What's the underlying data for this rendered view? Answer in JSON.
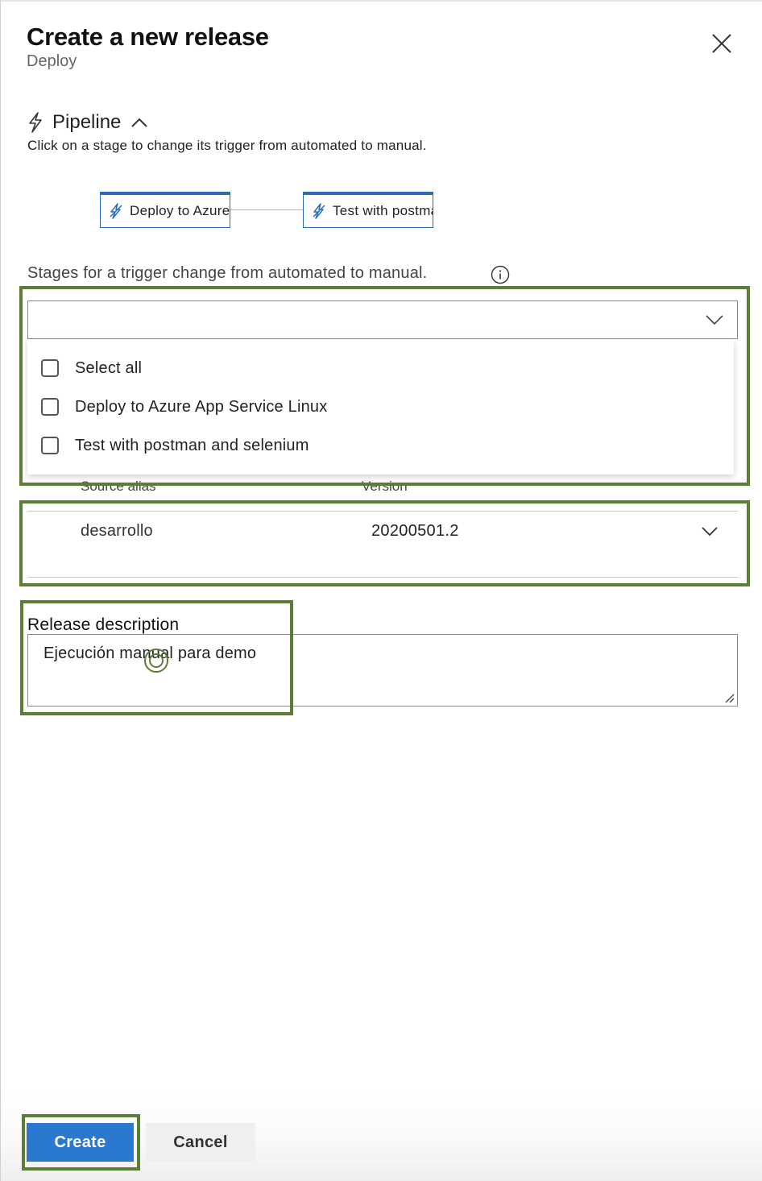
{
  "header": {
    "title": "Create a new release",
    "subtitle": "Deploy",
    "close_icon": "close-icon"
  },
  "pipeline": {
    "title": "Pipeline",
    "description": "Click on a stage to change its trigger from automated to manual.",
    "stages": [
      {
        "label": "Deploy to Azure App Service Linux",
        "icon": "lightning-icon"
      },
      {
        "label": "Test with postman and selenium",
        "icon": "lightning-icon"
      }
    ]
  },
  "trigger": {
    "label": "Stages for a trigger change from automated to manual.",
    "selected_value": "",
    "options": [
      {
        "label": "Select all",
        "checked": false
      },
      {
        "label": "Deploy to Azure App Service Linux",
        "checked": false
      },
      {
        "label": "Test with postman and selenium",
        "checked": false
      }
    ]
  },
  "artifacts": {
    "headers": {
      "alias": "Source alias",
      "version": "Version"
    },
    "rows": [
      {
        "alias": "desarrollo",
        "version": "20200501.2"
      }
    ]
  },
  "release_description": {
    "label": "Release description",
    "value": "Ejecución manual para demo"
  },
  "footer": {
    "create_label": "Create",
    "cancel_label": "Cancel"
  },
  "colors": {
    "primary": "#2b78d0",
    "stage_border": "#2b6cb8",
    "highlight": "#5a7e36"
  }
}
